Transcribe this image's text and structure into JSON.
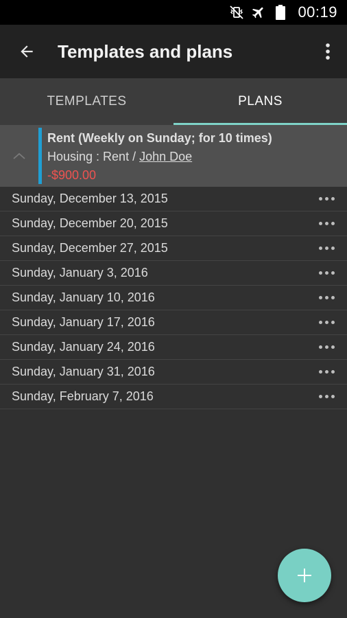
{
  "status_bar": {
    "time": "00:19",
    "icons": [
      "vibrate-mute-icon",
      "airplane-icon",
      "battery-icon"
    ]
  },
  "app_bar": {
    "title": "Templates and plans",
    "back_icon": "arrow-back-icon",
    "more_icon": "more-vert-icon"
  },
  "tabs": [
    {
      "label": "TEMPLATES",
      "active": false
    },
    {
      "label": "PLANS",
      "active": true
    }
  ],
  "plan": {
    "title": "Rent (Weekly on Sunday; for 10 times)",
    "category": "Housing : Rent / ",
    "payee": "John Doe",
    "amount": "-$900.00",
    "accent_color": "#1f9fd4",
    "amount_color": "#ef5350"
  },
  "instances": [
    {
      "date": "Sunday, December 13, 2015"
    },
    {
      "date": "Sunday, December 20, 2015"
    },
    {
      "date": "Sunday, December 27, 2015"
    },
    {
      "date": "Sunday, January 3, 2016"
    },
    {
      "date": "Sunday, January 10, 2016"
    },
    {
      "date": "Sunday, January 17, 2016"
    },
    {
      "date": "Sunday, January 24, 2016"
    },
    {
      "date": "Sunday, January 31, 2016"
    },
    {
      "date": "Sunday, February 7, 2016"
    }
  ],
  "fab": {
    "icon": "plus-icon",
    "color": "#79d0c4"
  }
}
